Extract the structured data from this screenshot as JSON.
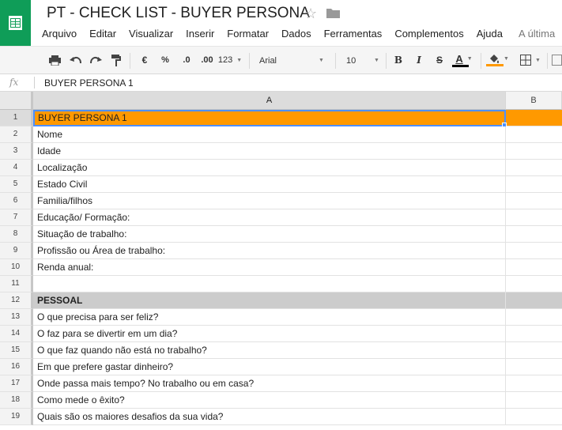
{
  "document": {
    "title": "PT - CHECK LIST - BUYER PERSONA"
  },
  "menu": {
    "items": [
      "Arquivo",
      "Editar",
      "Visualizar",
      "Inserir",
      "Formatar",
      "Dados",
      "Ferramentas",
      "Complementos",
      "Ajuda"
    ],
    "last_edit": "A última"
  },
  "toolbar": {
    "currency": "€",
    "percent": "%",
    "decrease_decimals": ".0",
    "increase_decimals": ".00",
    "more_formats": "123",
    "font": "Arial",
    "font_size": "10",
    "bold": "B",
    "italic": "I",
    "strikethrough": "S",
    "text_color_letter": "A",
    "text_color": "#000000",
    "fill_color": "#ff9900"
  },
  "formula_bar": {
    "fx": "fx",
    "value": "BUYER PERSONA 1"
  },
  "columns": [
    "A",
    "B"
  ],
  "rows": [
    {
      "num": "1",
      "text": "BUYER PERSONA 1",
      "style": "header"
    },
    {
      "num": "2",
      "text": "Nome",
      "style": ""
    },
    {
      "num": "3",
      "text": "Idade",
      "style": ""
    },
    {
      "num": "4",
      "text": "Localização",
      "style": ""
    },
    {
      "num": "5",
      "text": "Estado Civil",
      "style": ""
    },
    {
      "num": "6",
      "text": "Familia/filhos",
      "style": ""
    },
    {
      "num": "7",
      "text": "Educação/ Formação:",
      "style": ""
    },
    {
      "num": "8",
      "text": "Situação de trabalho:",
      "style": ""
    },
    {
      "num": "9",
      "text": "Profissão ou Área de trabalho:",
      "style": ""
    },
    {
      "num": "10",
      "text": "Renda anual:",
      "style": ""
    },
    {
      "num": "11",
      "text": "",
      "style": ""
    },
    {
      "num": "12",
      "text": "PESSOAL",
      "style": "section"
    },
    {
      "num": "13",
      "text": "O que precisa para ser feliz?",
      "style": ""
    },
    {
      "num": "14",
      "text": "O faz para se divertir em um dia?",
      "style": ""
    },
    {
      "num": "15",
      "text": "O que faz quando não está no trabalho?",
      "style": ""
    },
    {
      "num": "16",
      "text": "Em que prefere gastar dinheiro?",
      "style": ""
    },
    {
      "num": "17",
      "text": "Onde passa mais tempo? No trabalho ou em casa?",
      "style": ""
    },
    {
      "num": "18",
      "text": "Como mede o êxito?",
      "style": ""
    },
    {
      "num": "19",
      "text": "Quais são os maiores desafios da sua vida?",
      "style": ""
    }
  ],
  "selected_cell": "A1"
}
